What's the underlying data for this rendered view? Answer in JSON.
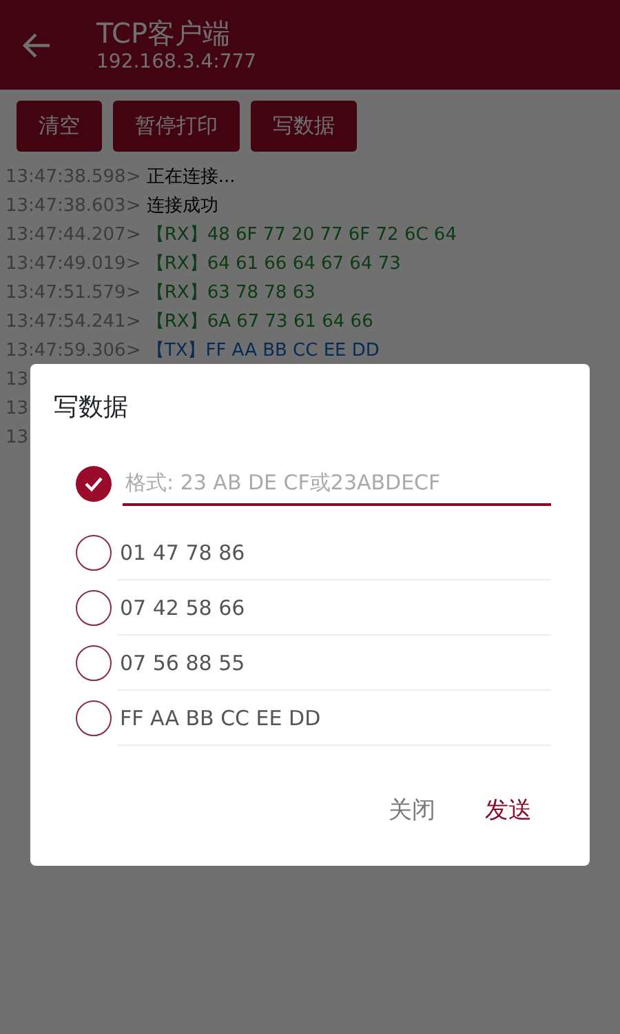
{
  "app_bar": {
    "title": "TCP客户端",
    "subtitle": "192.168.3.4:777"
  },
  "toolbar": [
    "清空",
    "暂停打印",
    "写数据"
  ],
  "log": [
    {
      "time": "13:47:38.598>",
      "text": "正在连接...",
      "kind": "status"
    },
    {
      "time": "13:47:38.603>",
      "text": "连接成功",
      "kind": "status"
    },
    {
      "time": "13:47:44.207>",
      "text": "【RX】48 6F 77 20 77 6F 72 6C 64",
      "kind": "rx"
    },
    {
      "time": "13:47:49.019>",
      "text": "【RX】64 61 66 64 67 64 73",
      "kind": "rx"
    },
    {
      "time": "13:47:51.579>",
      "text": "【RX】63 78 78 63",
      "kind": "rx"
    },
    {
      "time": "13:47:54.241>",
      "text": "【RX】6A 67 73 61 64 66",
      "kind": "rx"
    },
    {
      "time": "13:47:59.306>",
      "text": "【TX】FF AA BB CC EE DD",
      "kind": "tx"
    },
    {
      "time": "13"
    },
    {
      "time": "13"
    },
    {
      "time": "13"
    }
  ],
  "dialog": {
    "title": "写数据",
    "options": [
      {
        "kind": "input",
        "placeholder": "格式: 23 AB DE CF或23ABDECF",
        "selected": true
      },
      {
        "kind": "preset",
        "text": "01 47 78 86",
        "selected": false
      },
      {
        "kind": "preset",
        "text": "07 42 58 66",
        "selected": false
      },
      {
        "kind": "preset",
        "text": "07 56 88 55",
        "selected": false
      },
      {
        "kind": "preset",
        "text": "FF AA BB CC EE DD",
        "selected": false
      }
    ],
    "buttons": [
      {
        "label": "关闭",
        "kind": "secondary"
      },
      {
        "label": "发送",
        "kind": "primary"
      }
    ]
  }
}
